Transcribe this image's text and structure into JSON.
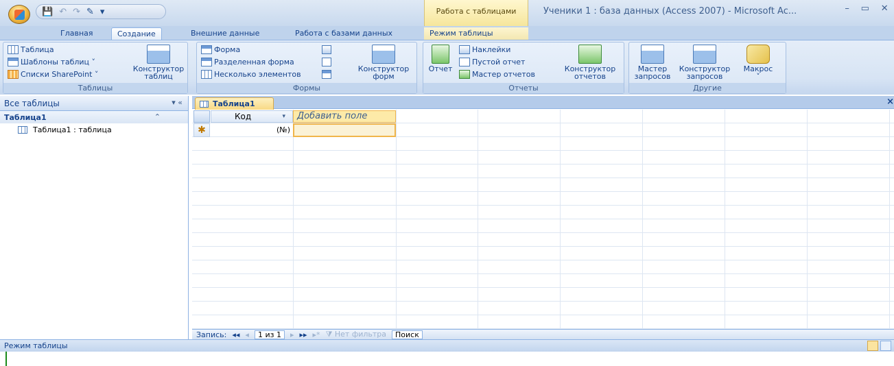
{
  "titlebar": {
    "context_tab_title": "Работа с таблицами",
    "window_title": "Ученики 1 : база данных (Access 2007) - Microsoft Ac...",
    "qat_icons": [
      "save-icon",
      "undo-icon",
      "redo-icon",
      "customize-icon"
    ],
    "window_controls": [
      "minimize",
      "restore",
      "close"
    ],
    "qat_separator": "▾",
    "ctrl_min": "–",
    "ctrl_restore": "▭",
    "ctrl_close": "✕"
  },
  "ribbon_tabs": [
    "Главная",
    "Создание",
    "Внешние данные",
    "Работа с базами данных",
    "Режим таблицы"
  ],
  "active_tab": "Создание",
  "ribbon": {
    "tables_group": {
      "label": "Таблицы",
      "table": "Таблица",
      "templates": "Шаблоны таблиц ˅",
      "sharepoint": "Списки SharePoint ˅",
      "designer_line1": "Конструктор",
      "designer_line2": "таблиц"
    },
    "forms_group": {
      "label": "Формы",
      "form": "Форма",
      "split_form": "Разделенная форма",
      "multi_items": "Несколько элементов",
      "designer_line1": "Конструктор",
      "designer_line2": "форм"
    },
    "reports_group": {
      "label": "Отчеты",
      "report": "Отчет",
      "labels": "Наклейки",
      "blank_report": "Пустой отчет",
      "report_wizard": "Мастер отчетов",
      "designer_line1": "Конструктор",
      "designer_line2": "отчетов"
    },
    "other_group": {
      "label": "Другие",
      "query_wizard_line1": "Мастер",
      "query_wizard_line2": "запросов",
      "query_designer_line1": "Конструктор",
      "query_designer_line2": "запросов",
      "macro": "Макрос",
      "macro_arrow": "˅"
    }
  },
  "nav_pane": {
    "header": "Все таблицы",
    "header_controls": "▾  «",
    "group_title": "Таблица1",
    "collapse_glyph": "⌃",
    "item": "Таблица1 : таблица"
  },
  "document": {
    "tab_title": "Таблица1",
    "close_glyph": "×",
    "columns": [
      "Код",
      "Добавить поле"
    ],
    "column_dropdown_glyph": "▾",
    "new_row_marker": "✱",
    "new_row_kod": "(№)",
    "record_nav": {
      "label": "Запись:",
      "first": "◂◂",
      "prev": "◂",
      "position": "1 из 1",
      "next": "▸",
      "last": "▸▸",
      "new": "▸*",
      "filter": "Нет фильтра",
      "search": "Поиск"
    }
  },
  "statusbar": {
    "text": "Режим таблицы"
  }
}
